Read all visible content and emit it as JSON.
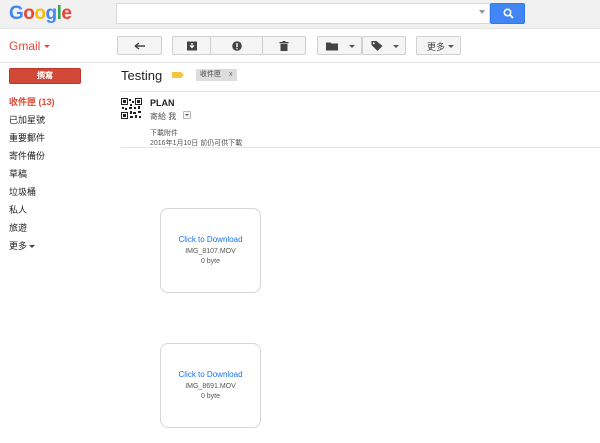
{
  "header": {
    "logo_letters": [
      {
        "ch": "G",
        "color": "#4285f4"
      },
      {
        "ch": "o",
        "color": "#ea4335"
      },
      {
        "ch": "o",
        "color": "#fbbc05"
      },
      {
        "ch": "g",
        "color": "#4285f4"
      },
      {
        "ch": "l",
        "color": "#34a853"
      },
      {
        "ch": "e",
        "color": "#ea4335"
      }
    ],
    "search_value": "",
    "search_icon": "search-icon"
  },
  "toolbar": {
    "app_label": "Gmail",
    "back_icon": "reply-icon",
    "archive_icon": "archive-icon",
    "spam_icon": "report-spam-icon",
    "delete_icon": "trash-icon",
    "move_icon": "folder-icon",
    "labels_icon": "label-icon",
    "more_label": "更多"
  },
  "sidebar": {
    "compose_label": "撰寫",
    "items": [
      {
        "label": "收件匣 (13)",
        "active": true
      },
      {
        "label": "已加星號",
        "active": false
      },
      {
        "label": "重要郵件",
        "active": false
      },
      {
        "label": "寄件備份",
        "active": false
      },
      {
        "label": "草稿",
        "active": false
      },
      {
        "label": "垃圾桶",
        "active": false
      },
      {
        "label": "私人",
        "active": false
      },
      {
        "label": "旅遊",
        "active": false
      }
    ],
    "more_label": "更多"
  },
  "thread": {
    "subject": "Testing",
    "label_chip": "收件匣",
    "label_chip_close": "x",
    "label_color": "#f6c342",
    "sender": "PLAN",
    "to_line": "寄給 我",
    "attachment_heading": "下載附件",
    "attachment_note": "2016年1月10日 前仍可供下載"
  },
  "attachments": [
    {
      "link": "Click to Download",
      "filename": "IMG_8107.MOV",
      "size": "0 byte"
    },
    {
      "link": "Click to Download",
      "filename": "IMG_8691.MOV",
      "size": "0 byte"
    }
  ],
  "colors": {
    "accent_red": "#dd4b39",
    "compose_red": "#d14836",
    "search_blue": "#4285f4",
    "link_blue": "#1a73e8"
  }
}
